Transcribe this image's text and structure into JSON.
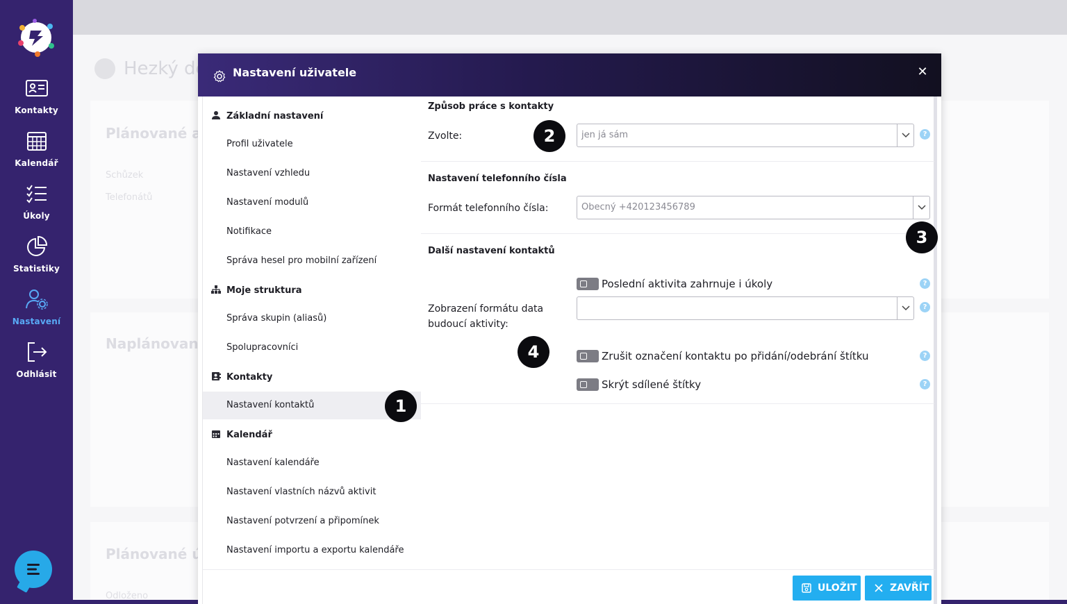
{
  "sidebar": {
    "items": [
      {
        "label": "Kontakty",
        "icon": "contact-card-icon"
      },
      {
        "label": "Kalendář",
        "icon": "calendar-icon"
      },
      {
        "label": "Úkoly",
        "icon": "tasks-icon"
      },
      {
        "label": "Statistiky",
        "icon": "pie-chart-icon"
      },
      {
        "label": "Nastavení",
        "icon": "user-settings-icon"
      },
      {
        "label": "Odhlásit",
        "icon": "logout-icon"
      }
    ],
    "active": "Nastavení"
  },
  "background": {
    "greeting": "Hezký de",
    "card1_title": "Plánované ak",
    "card1_row1": "Schůzek",
    "card1_row2": "Telefonátů",
    "card2_title": "Naplánované",
    "card3_title": "Plánované úk",
    "card3_row1": "Odloženo"
  },
  "modal": {
    "title": "Nastavení uživatele",
    "menu": {
      "sections": [
        {
          "label": "Základní nastavení",
          "items": [
            "Profil uživatele",
            "Nastavení vzhledu",
            "Nastavení modulů",
            "Notifikace",
            "Správa hesel pro mobilní zařízení"
          ]
        },
        {
          "label": "Moje struktura",
          "items": [
            "Správa skupin (aliasů)",
            "Spolupracovníci"
          ]
        },
        {
          "label": "Kontakty",
          "items": [
            "Nastavení kontaktů"
          ]
        },
        {
          "label": "Kalendář",
          "items": [
            "Nastavení kalendáře",
            "Nastavení vlastních názvů aktivit",
            "Nastavení potvrzení a připomínek",
            "Nastavení importu a exportu kalendáře"
          ]
        }
      ],
      "selected": "Nastavení kontaktů"
    },
    "content": {
      "section1_title": "Způsob práce s kontakty",
      "choose_label": "Zvolte:",
      "choose_value": "jen já sám",
      "section2_title": "Nastavení telefonního čísla",
      "phone_format_label": "Formát telefonního čísla:",
      "phone_format_value": "Obecný +420123456789",
      "section3_title": "Další nastavení kontaktů",
      "toggle1_label": "Poslední aktivita zahrnuje i úkoly",
      "date_format_label_line1": "Zobrazení formátu data",
      "date_format_label_line2": "budoucí aktivity:",
      "date_format_value": "",
      "toggle2_label": "Zrušit označení kontaktu po přidání/odebrání štítku",
      "toggle3_label": "Skrýt sdílené štítky",
      "help_glyph": "?"
    },
    "footer": {
      "save_label": "ULOŽIT",
      "close_label": "ZAVŘÍT"
    },
    "close_glyph": "✕"
  },
  "badges": [
    "1",
    "2",
    "3",
    "4"
  ],
  "colors": {
    "sidebar_bg": "#35236e",
    "active_nav": "#58a9f5",
    "button": "#23aef0",
    "header_start": "#3a2a78",
    "header_end": "#121020"
  }
}
